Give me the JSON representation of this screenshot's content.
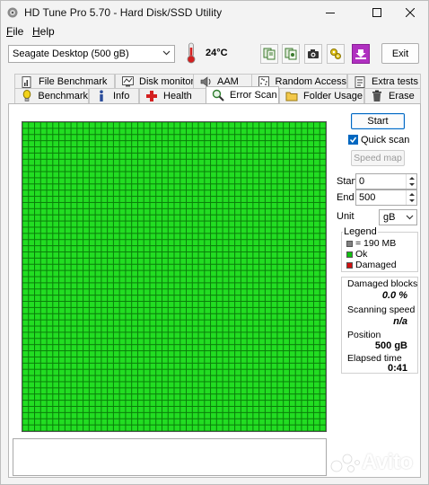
{
  "window": {
    "title": "HD Tune Pro 5.70 - Hard Disk/SSD Utility"
  },
  "menu": [
    {
      "key": "F",
      "rest": "ile"
    },
    {
      "key": "H",
      "rest": "elp"
    }
  ],
  "toolbar": {
    "drive": "Seagate Desktop (500 gB)",
    "temperature": "24°C",
    "exit_label": "Exit"
  },
  "tabs_row1": [
    {
      "label": "File Benchmark",
      "icon": "file-benchmark-icon"
    },
    {
      "label": "Disk monitor",
      "icon": "disk-monitor-icon"
    },
    {
      "label": "AAM",
      "icon": "speaker-icon"
    },
    {
      "label": "Random Access",
      "icon": "random-access-icon"
    },
    {
      "label": "Extra tests",
      "icon": "extra-tests-icon"
    }
  ],
  "tabs_row2": [
    {
      "label": "Benchmark",
      "icon": "benchmark-icon"
    },
    {
      "label": "Info",
      "icon": "info-icon"
    },
    {
      "label": "Health",
      "icon": "health-icon"
    },
    {
      "label": "Error Scan",
      "icon": "magnifier-icon",
      "active": true
    },
    {
      "label": "Folder Usage",
      "icon": "folder-icon"
    },
    {
      "label": "Erase",
      "icon": "trash-icon"
    }
  ],
  "scan": {
    "start_label": "Start",
    "quick_scan_label": "Quick scan",
    "quick_scan_checked": true,
    "speed_map_label": "Speed map",
    "start_field_label": "Start",
    "start_value": "0",
    "end_field_label": "End",
    "end_value": "500",
    "unit_label": "Unit",
    "unit_value": "gB",
    "grid_columns": 50,
    "grid_rows": 50,
    "block_status": "ok"
  },
  "legend": {
    "title": "Legend",
    "items": [
      {
        "label": "= 190 MB",
        "color": "#808080"
      },
      {
        "label": "Ok",
        "color": "#10c010"
      },
      {
        "label": "Damaged",
        "color": "#d01010"
      }
    ]
  },
  "stats": {
    "damaged_blocks_label": "Damaged blocks",
    "damaged_blocks_value": "0.0 %",
    "scanning_speed_label": "Scanning speed",
    "scanning_speed_value": "n/a",
    "position_label": "Position",
    "position_value": "500 gB",
    "elapsed_time_label": "Elapsed time",
    "elapsed_time_value": "0:41"
  },
  "colors": {
    "ok_block": "#22dd22",
    "grid_line": "#0a7d0a",
    "accent": "#0067c0"
  },
  "watermark": {
    "text": "Avito"
  }
}
